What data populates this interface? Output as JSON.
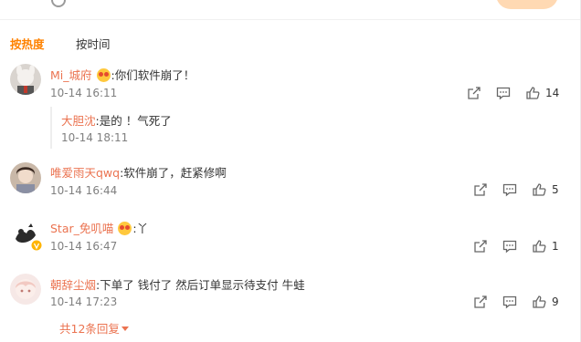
{
  "sort": {
    "hot_label": "按热度",
    "time_label": "按时间"
  },
  "comments": [
    {
      "username": "Mi_城府",
      "text": ":你们软件崩了！",
      "has_emoji": true,
      "time": "10-14 16:11",
      "likes": "14",
      "reply": {
        "username": "大胆沈",
        "text": ":是的 ！气死了",
        "time": "10-14 18:11"
      }
    },
    {
      "username": "唯爱雨天qwq",
      "text": ":软件崩了，赶紧修啊",
      "has_emoji": false,
      "time": "10-14 16:44",
      "likes": "5"
    },
    {
      "username": "Star_免叽喵",
      "text": ":丫",
      "has_emoji": true,
      "time": "10-14 16:47",
      "likes": "1"
    },
    {
      "username": "朝辞尘烟",
      "text": ":下单了 钱付了 然后订单显示待支付 牛蛙",
      "has_emoji": false,
      "time": "10-14 17:23",
      "likes": "9"
    }
  ],
  "more_replies_label": "共12条回复",
  "icons": {
    "share": "share-icon",
    "comment": "comment-icon",
    "like": "thumbs-up-icon",
    "emoji": "grinning-emoji-icon"
  },
  "colors": {
    "accent": "#ff8200",
    "username": "#eb7350",
    "muted": "#808080"
  }
}
